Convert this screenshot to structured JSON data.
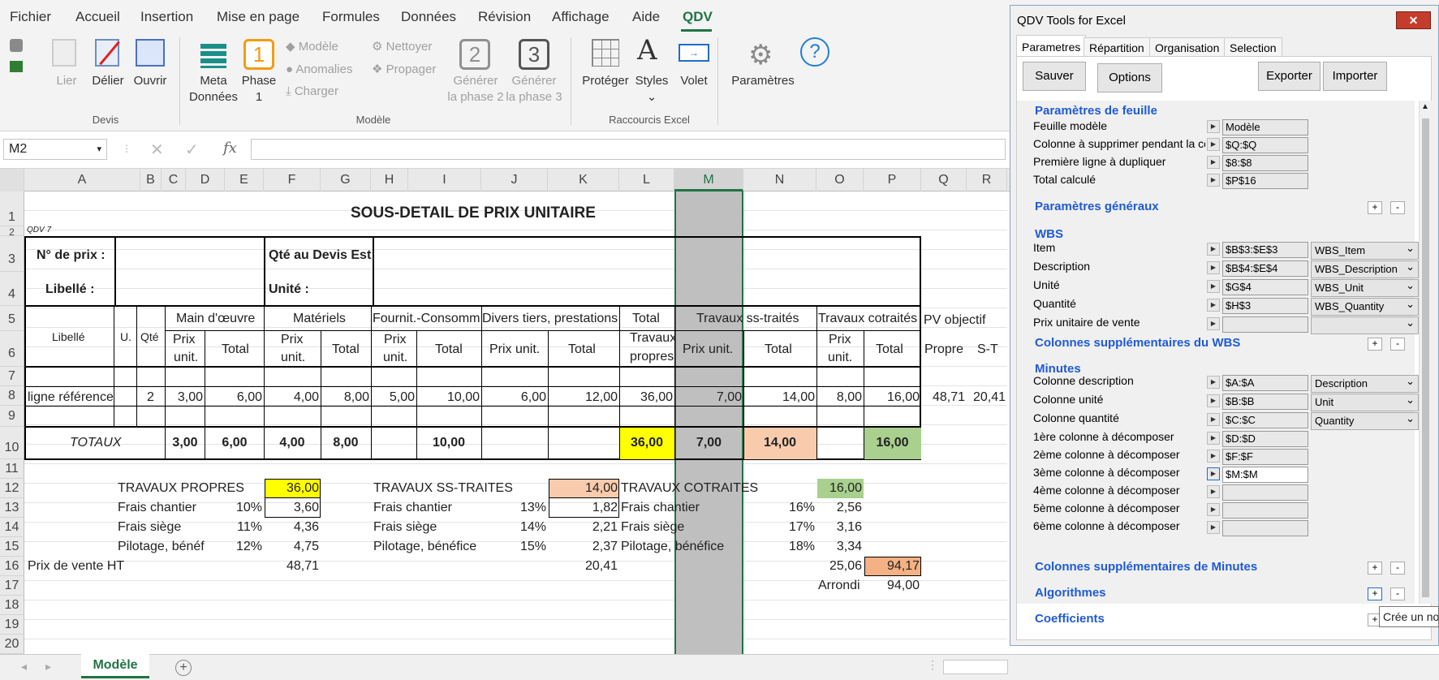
{
  "menu": [
    "Fichier",
    "Accueil",
    "Insertion",
    "Mise en page",
    "Formules",
    "Données",
    "Révision",
    "Affichage",
    "Aide",
    "QDV"
  ],
  "ribbon": {
    "devis": {
      "lier": "Lier",
      "delier": "Délier",
      "ouvrir": "Ouvrir",
      "group": "Devis"
    },
    "modele": {
      "meta1": "Meta",
      "meta2": "Données",
      "phase_num": "1",
      "phase1": "Phase",
      "phase2": "1",
      "modele": "Modèle",
      "anomalies": "Anomalies",
      "charger": "Charger",
      "nettoyer": "Nettoyer",
      "propager": "Propager",
      "gen2_num": "2",
      "gen3_num": "3",
      "gen2a": "Générer",
      "gen2b": "la phase 2",
      "gen3a": "Générer",
      "gen3b": "la phase 3",
      "group": "Modèle"
    },
    "raccourcis": {
      "proteger": "Protéger",
      "styles": "Styles",
      "volet": "Volet",
      "group": "Raccourcis Excel"
    },
    "parametres": "Paramètres"
  },
  "formula": {
    "namebox": "M2",
    "fx": "fx"
  },
  "columns": [
    "A",
    "B",
    "C",
    "D",
    "E",
    "F",
    "G",
    "H",
    "I",
    "J",
    "K",
    "L",
    "M",
    "N",
    "O",
    "P",
    "Q",
    "R"
  ],
  "rows": [
    "1",
    "2",
    "3",
    "4",
    "5",
    "6",
    "7",
    "8",
    "9",
    "10",
    "11",
    "12",
    "13",
    "14",
    "15",
    "16",
    "17",
    "18",
    "19",
    "20"
  ],
  "sheet": {
    "title": "SOUS-DETAIL DE PRIX UNITAIRE",
    "qdv": "QDV 7",
    "prix_label": "N° de prix :",
    "qte_label": "Qté au Devis Est:",
    "libelle_label": "Libellé :",
    "unite_label": "Unité :",
    "h_libelle": "Libellé",
    "h_u": "U.",
    "h_qte": "Qté",
    "h_mo": "Main d'œuvre",
    "h_mat": "Matériels",
    "h_fourn": "Fournit.-Consomm",
    "h_divers": "Divers tiers, prestations",
    "h_total1": "Total",
    "h_total2": "Travaux",
    "h_total3": "propres",
    "h_ss": "Travaux ss-traités",
    "h_cot": "Travaux cotraités",
    "h_pv": "PV objectif",
    "prix": "Prix",
    "unit": "unit.",
    "total": "Total",
    "prix_unit": "Prix unit.",
    "propre": "Propre",
    "st": "S-T",
    "r8": [
      "ligne référence",
      "2",
      "3,00",
      "6,00",
      "4,00",
      "8,00",
      "5,00",
      "10,00",
      "6,00",
      "12,00",
      "36,00",
      "7,00",
      "14,00",
      "8,00",
      "16,00",
      "48,71",
      "20,41"
    ],
    "totaux": "TOTAUX",
    "r10": [
      "3,00",
      "6,00",
      "4,00",
      "8,00",
      "10,00",
      "36,00",
      "7,00",
      "14,00",
      "16,00"
    ],
    "tp": "TRAVAUX PROPRES",
    "tp_v": "36,00",
    "ts": "TRAVAUX SS-TRAITES",
    "ts_v": "14,00",
    "tc": "TRAVAUX COTRAITES",
    "tc_v": "16,00",
    "fc": "Frais chantier",
    "fs": "Frais siège",
    "pil1": "Pilotage, bénéf",
    "pil2": "Pilotage, bénéfice",
    "a13": [
      "10%",
      "3,60"
    ],
    "a14": [
      "11%",
      "4,36"
    ],
    "a15": [
      "12%",
      "4,75"
    ],
    "b13": [
      "13%",
      "1,82"
    ],
    "b14": [
      "14%",
      "2,21"
    ],
    "b15": [
      "15%",
      "2,37"
    ],
    "c13": [
      "16%",
      "2,56"
    ],
    "c14": [
      "17%",
      "3,16"
    ],
    "c15": [
      "18%",
      "3,34"
    ],
    "pv": "Prix de vente HT",
    "pv_a": "48,71",
    "pv_b": "20,41",
    "pv_c": "25,06",
    "pv_t": "94,17",
    "arrondi": "Arrondi",
    "arrondi_v": "94,00"
  },
  "tabs": {
    "modele": "Modèle"
  },
  "panel": {
    "title": "QDV Tools for Excel",
    "tabs": [
      "Parametres",
      "Répartition",
      "Organisation",
      "Selection"
    ],
    "buttons": {
      "sauver": "Sauver",
      "options": "Options",
      "exporter": "Exporter",
      "importer": "Importer"
    },
    "sec_feuille": "Paramètres de feuille",
    "feuille": [
      {
        "l": "Feuille modèle",
        "v": "Modèle"
      },
      {
        "l": "Colonne à supprimer pendant la copie",
        "v": "$Q:$Q"
      },
      {
        "l": "Première ligne à dupliquer",
        "v": "$8:$8"
      },
      {
        "l": "Total calculé",
        "v": "$P$16"
      }
    ],
    "sec_generaux": "Paramètres généraux",
    "sec_wbs": "WBS",
    "wbs": [
      {
        "l": "Item",
        "v": "$B$3:$E$3",
        "d": "WBS_Item"
      },
      {
        "l": "Description",
        "v": "$B$4:$E$4",
        "d": "WBS_Description"
      },
      {
        "l": "Unité",
        "v": "$G$4",
        "d": "WBS_Unit"
      },
      {
        "l": "Quantité",
        "v": "$H$3",
        "d": "WBS_Quantity"
      },
      {
        "l": "Prix unitaire de vente",
        "v": "",
        "d": ""
      }
    ],
    "sec_col_wbs": "Colonnes supplémentaires du WBS",
    "sec_minutes": "Minutes",
    "minutes": [
      {
        "l": "Colonne description",
        "v": "$A:$A",
        "d": "Description"
      },
      {
        "l": "Colonne unité",
        "v": "$B:$B",
        "d": "Unit"
      },
      {
        "l": "Colonne quantité",
        "v": "$C:$C",
        "d": "Quantity"
      }
    ],
    "decomp": [
      {
        "l": "1ère colonne à décomposer",
        "v": "$D:$D"
      },
      {
        "l": "2ème colonne à décomposer",
        "v": "$F:$F"
      },
      {
        "l": "3ème colonne à décomposer",
        "v": "$M:$M"
      },
      {
        "l": "4ème colonne à décomposer",
        "v": ""
      },
      {
        "l": "5ème colonne à décomposer",
        "v": ""
      },
      {
        "l": "6ème colonne à décomposer",
        "v": ""
      }
    ],
    "sec_col_min": "Colonnes supplémentaires de Minutes",
    "sec_algo": "Algorithmes",
    "sec_coef": "Coefficients",
    "tooltip": "Crée un no"
  },
  "colors": {
    "accent": "#217346",
    "link": "#1f5bd6",
    "yellow": "#ffff00",
    "peach": "#f8cbad",
    "green": "#a9d08e",
    "orange": "#f4b183",
    "gray": "#bfbfbf"
  }
}
